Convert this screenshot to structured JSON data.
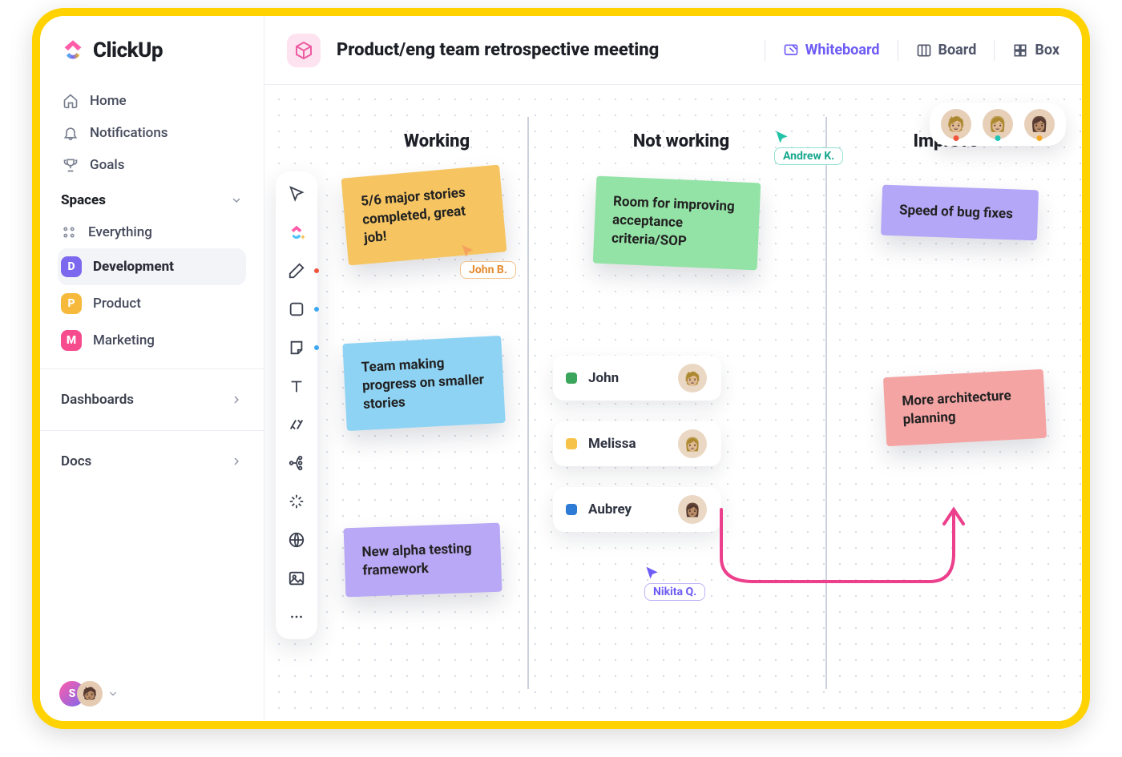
{
  "brand": "ClickUp",
  "nav": {
    "home": "Home",
    "notifications": "Notifications",
    "goals": "Goals"
  },
  "spaces_label": "Spaces",
  "spaces": {
    "everything": "Everything",
    "development": {
      "badge": "D",
      "label": "Development",
      "color": "#7B68EE"
    },
    "product": {
      "badge": "P",
      "label": "Product",
      "color": "#F6B93B"
    },
    "marketing": {
      "badge": "M",
      "label": "Marketing",
      "color": "#F64C8E"
    }
  },
  "dashboards_label": "Dashboards",
  "docs_label": "Docs",
  "user_initial": "S",
  "doc_title": "Product/eng team retrospective meeting",
  "views": {
    "whiteboard": "Whiteboard",
    "board": "Board",
    "box": "Box"
  },
  "columns": {
    "working": "Working",
    "not_working": "Not working",
    "improve": "Improve"
  },
  "notes": {
    "n1": "5/6 major stories completed, great job!",
    "n2": "Team making progress on smaller stories",
    "n3": "New alpha testing framework",
    "n4": "Room for improving acceptance criteria/SOP",
    "n5": "Speed of bug fixes",
    "n6": "More architecture planning"
  },
  "people": {
    "john": "John",
    "melissa": "Melissa",
    "aubrey": "Aubrey"
  },
  "cursors": {
    "john_b": "John B.",
    "andrew_k": "Andrew K.",
    "nikita_q": "Nikita Q."
  }
}
